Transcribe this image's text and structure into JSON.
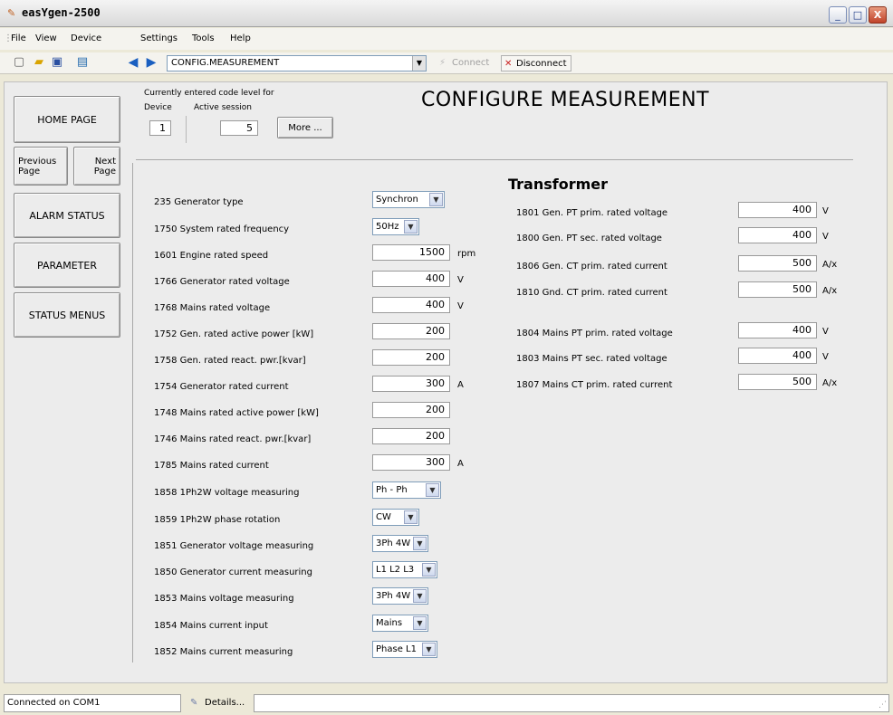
{
  "window": {
    "title": "easYgen-2500",
    "minimize": "_",
    "maximize": "□",
    "close": "X"
  },
  "menu": [
    "File",
    "View",
    "Device",
    "Settings",
    "Tools",
    "Help"
  ],
  "toolbar": {
    "address": "CONFIG.MEASUREMENT",
    "connect": "Connect",
    "disconnect": "Disconnect"
  },
  "nav": {
    "home": "HOME PAGE",
    "previous": "Previous Page",
    "next": "Next Page",
    "alarm": "ALARM STATUS",
    "parameter": "PARAMETER",
    "status_menus": "STATUS MENUS"
  },
  "code_level": {
    "caption": "Currently entered code level for",
    "device_label": "Device",
    "session_label": "Active session",
    "device_value": "1",
    "session_value": "5",
    "more_button": "More ..."
  },
  "page_title": "CONFIGURE MEASUREMENT",
  "left_params": [
    {
      "label": "235 Generator type",
      "value": "Synchron",
      "kind": "select",
      "unit": ""
    },
    {
      "label": "1750 System rated frequency",
      "value": "50Hz",
      "kind": "select",
      "unit": ""
    },
    {
      "label": "1601 Engine rated speed",
      "value": "1500",
      "kind": "field",
      "unit": "rpm"
    },
    {
      "label": "1766 Generator rated voltage",
      "value": "400",
      "kind": "field",
      "unit": "V"
    },
    {
      "label": "1768 Mains rated voltage",
      "value": "400",
      "kind": "field",
      "unit": "V"
    },
    {
      "label": "1752 Gen. rated active power [kW]",
      "value": "200",
      "kind": "field",
      "unit": ""
    },
    {
      "label": "1758 Gen. rated react. pwr.[kvar]",
      "value": "200",
      "kind": "field",
      "unit": ""
    },
    {
      "label": "1754 Generator rated current",
      "value": "300",
      "kind": "field",
      "unit": "A"
    },
    {
      "label": "1748 Mains rated active power [kW]",
      "value": "200",
      "kind": "field",
      "unit": ""
    },
    {
      "label": "1746 Mains rated react. pwr.[kvar]",
      "value": "200",
      "kind": "field",
      "unit": ""
    },
    {
      "label": "1785 Mains rated current",
      "value": "300",
      "kind": "field",
      "unit": "A"
    },
    {
      "label": "1858 1Ph2W voltage measuring",
      "value": "Ph - Ph",
      "kind": "select",
      "unit": ""
    },
    {
      "label": "1859 1Ph2W phase rotation",
      "value": "CW",
      "kind": "select",
      "unit": ""
    },
    {
      "label": "1851 Generator voltage measuring",
      "value": "3Ph 4W",
      "kind": "select",
      "unit": ""
    },
    {
      "label": "1850 Generator current measuring",
      "value": "L1 L2 L3",
      "kind": "select",
      "unit": ""
    },
    {
      "label": "1853 Mains voltage measuring",
      "value": "3Ph 4W",
      "kind": "select",
      "unit": ""
    },
    {
      "label": "1854 Mains current input",
      "value": "Mains",
      "kind": "select",
      "unit": ""
    },
    {
      "label": "1852 Mains current measuring",
      "value": "Phase L1",
      "kind": "select",
      "unit": ""
    }
  ],
  "transformer": {
    "title": "Transformer",
    "params": [
      {
        "label": "1801 Gen. PT prim. rated voltage",
        "value": "400",
        "unit": "V"
      },
      {
        "label": "1800 Gen. PT sec. rated voltage",
        "value": "400",
        "unit": "V"
      },
      {
        "label": "1806 Gen. CT prim. rated current",
        "value": "500",
        "unit": "A/x"
      },
      {
        "label": "1810 Gnd. CT prim. rated current",
        "value": "500",
        "unit": "A/x"
      },
      {
        "label": "1804 Mains PT prim. rated voltage",
        "value": "400",
        "unit": "V"
      },
      {
        "label": "1803 Mains PT sec. rated voltage",
        "value": "400",
        "unit": "V"
      },
      {
        "label": "1807 Mains CT prim. rated current",
        "value": "500",
        "unit": "A/x"
      }
    ]
  },
  "status": {
    "connection": "Connected on COM1",
    "details": "Details..."
  }
}
